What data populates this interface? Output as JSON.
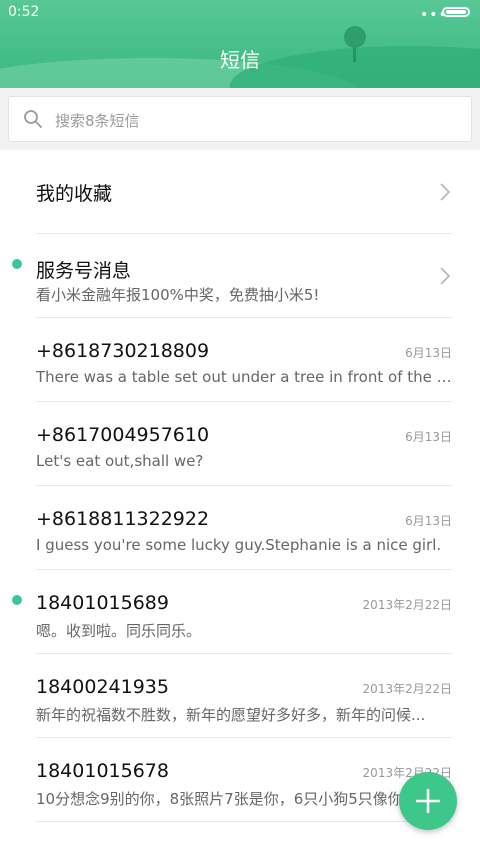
{
  "status_bar": {
    "time": "0:52",
    "dots": "•••"
  },
  "header": {
    "title": "短信"
  },
  "search": {
    "placeholder": "搜索8条短信"
  },
  "favorites": {
    "label": "我的收藏"
  },
  "threads": [
    {
      "name": "服务号消息",
      "preview": "看小米金融年报100%中奖，免费抽小米5!",
      "date": "",
      "unread": true,
      "chevron": true
    },
    {
      "name": "+8618730218809",
      "preview": "There was a table set out under a tree in front of the ho...",
      "date": "6月13日",
      "unread": false
    },
    {
      "name": "+8617004957610",
      "preview": "Let's eat out,shall we?",
      "date": "6月13日",
      "unread": false
    },
    {
      "name": "+8618811322922",
      "preview": "I guess you're some lucky guy.Stephanie is a nice girl.",
      "date": "6月13日",
      "unread": false
    },
    {
      "name": "18401015689",
      "preview": "嗯。收到啦。同乐同乐。",
      "date": "2013年2月22日",
      "unread": true
    },
    {
      "name": "18400241935",
      "preview": "新年的祝福数不胜数，新年的愿望好多好多，新年的问候...",
      "date": "2013年2月22日",
      "unread": false
    },
    {
      "name": "18401015678",
      "preview": "10分想念9别的你，8张照片7张是你，6只小狗5只像你",
      "date": "2013年2月22日",
      "unread": false
    }
  ],
  "colors": {
    "accent": "#3ec78a",
    "unread": "#38c6a1",
    "header": "#46bf8a"
  },
  "icons": {
    "search": "search-icon",
    "chevron": "chevron-right-icon",
    "compose": "plus-icon"
  }
}
